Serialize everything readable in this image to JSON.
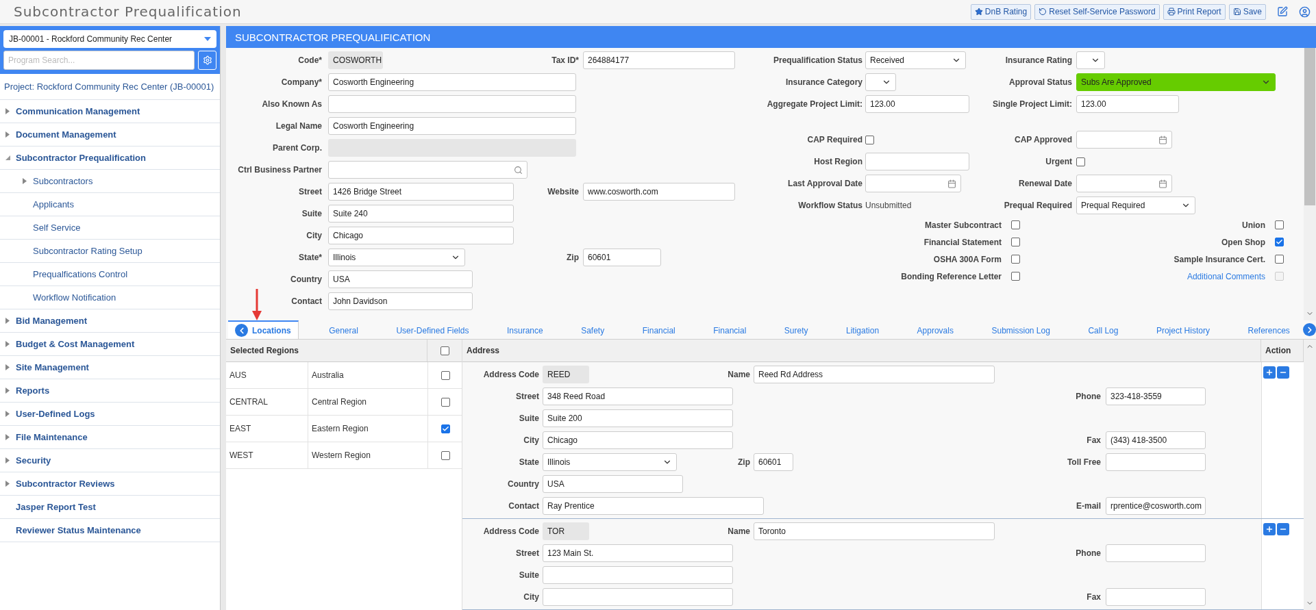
{
  "app": {
    "title": "Subcontractor Prequalification",
    "actions": [
      {
        "label": "DnB Rating"
      },
      {
        "label": "Reset Self-Service Password"
      },
      {
        "label": "Print Report"
      },
      {
        "label": "Save"
      }
    ]
  },
  "sidebar": {
    "project_select": "JB-00001 - Rockford Community Rec Center",
    "search_placeholder": "Program Search...",
    "project_link": "Project: Rockford Community Rec Center (JB-00001)",
    "nav": [
      {
        "label": "Communication Management",
        "expandable": true,
        "expanded": false
      },
      {
        "label": "Document Management",
        "expandable": true,
        "expanded": false
      },
      {
        "label": "Subcontractor Prequalification",
        "expandable": true,
        "expanded": true,
        "children": [
          {
            "label": "Subcontractors",
            "expandable": true,
            "expanded": false
          },
          {
            "label": "Applicants",
            "expandable": false
          },
          {
            "label": "Self Service",
            "expandable": false
          },
          {
            "label": "Subcontractor Rating Setup",
            "expandable": false
          },
          {
            "label": "Prequalfications Control",
            "expandable": false
          },
          {
            "label": "Workflow Notification",
            "expandable": false
          }
        ]
      },
      {
        "label": "Bid Management",
        "expandable": true,
        "expanded": false
      },
      {
        "label": "Budget & Cost Management",
        "expandable": true,
        "expanded": false
      },
      {
        "label": "Site Management",
        "expandable": true,
        "expanded": false
      },
      {
        "label": "Reports",
        "expandable": true,
        "expanded": false
      },
      {
        "label": "User-Defined Logs",
        "expandable": true,
        "expanded": false
      },
      {
        "label": "File Maintenance",
        "expandable": true,
        "expanded": false
      },
      {
        "label": "Security",
        "expandable": true,
        "expanded": false
      },
      {
        "label": "Subcontractor Reviews",
        "expandable": true,
        "expanded": false
      },
      {
        "label": "Jasper Report Test",
        "expandable": false
      },
      {
        "label": "Reviewer Status Maintenance",
        "expandable": false
      }
    ]
  },
  "form": {
    "title": "SUBCONTRACTOR PREQUALIFICATION",
    "identity_rows": [
      {
        "main": {
          "label": "Code*",
          "kind": "readonly",
          "value": "COSWORTH"
        },
        "side": {
          "label": "Tax ID*",
          "kind": "text",
          "value": "264884177"
        }
      },
      {
        "main": {
          "label": "Company*",
          "kind": "text",
          "value": "Cosworth Engineering"
        }
      },
      {
        "main": {
          "label": "Also Known As",
          "kind": "text"
        }
      },
      {
        "main": {
          "label": "Legal Name",
          "kind": "text",
          "value": "Cosworth Engineering"
        }
      },
      {
        "main": {
          "label": "Parent Corp.",
          "kind": "readonly"
        }
      },
      {
        "main": {
          "label": "Ctrl Business Partner",
          "kind": "lookup"
        }
      },
      {
        "main": {
          "label": "Street",
          "kind": "text",
          "value": "1426 Bridge Street"
        },
        "side": {
          "label": "Website",
          "kind": "text",
          "value": "www.cosworth.com"
        }
      },
      {
        "main": {
          "label": "Suite",
          "kind": "text",
          "value": "Suite 240"
        }
      },
      {
        "main": {
          "label": "City",
          "kind": "text",
          "value": "Chicago"
        }
      },
      {
        "main": {
          "label": "State*",
          "kind": "select",
          "value": "Illinois"
        },
        "side": {
          "label": "Zip",
          "kind": "text",
          "value": "60601"
        }
      },
      {
        "main": {
          "label": "Country",
          "kind": "text",
          "value": "USA"
        }
      },
      {
        "main": {
          "label": "Contact",
          "kind": "text",
          "value": "John Davidson"
        }
      }
    ],
    "status_groups": [
      [
        {
          "main": {
            "label": "Prequalification Status",
            "kind": "select",
            "value": "Received"
          },
          "side": {
            "label": "Insurance Rating",
            "kind": "select"
          }
        },
        {
          "main": {
            "label": "Insurance Category",
            "kind": "select"
          },
          "side": {
            "label": "Approval Status",
            "kind": "select",
            "value": "Subs Are Approved",
            "color": "#66cc00"
          }
        },
        {
          "main": {
            "label": "Aggregate Project Limit:",
            "kind": "text",
            "value": "123.00"
          },
          "side": {
            "label": "Single Project Limit:",
            "kind": "text",
            "value": "123.00"
          }
        }
      ],
      [
        {
          "main": {
            "label": "CAP Required",
            "kind": "checkbox",
            "checked": false
          },
          "side": {
            "label": "CAP Approved",
            "kind": "date"
          }
        },
        {
          "main": {
            "label": "Host Region",
            "kind": "text"
          },
          "side": {
            "label": "Urgent",
            "kind": "checkbox",
            "checked": false
          }
        },
        {
          "main": {
            "label": "Last Approval Date",
            "kind": "date"
          },
          "side": {
            "label": "Renewal Date",
            "kind": "date"
          }
        },
        {
          "main": {
            "label": "Workflow Status",
            "kind": "static",
            "value": "Unsubmitted"
          },
          "side": {
            "label": "Prequal Required",
            "kind": "select",
            "value": "Prequal Required"
          }
        }
      ]
    ],
    "document_checks": [
      {
        "main": {
          "label": "Master Subcontract",
          "kind": "plain",
          "checked": false,
          "disabled": false
        },
        "side": {
          "label": "Union",
          "kind": "plain",
          "checked": false,
          "disabled": false
        }
      },
      {
        "main": {
          "label": "Financial Statement",
          "kind": "plain",
          "checked": false,
          "disabled": false
        },
        "side": {
          "label": "Open Shop",
          "kind": "plain",
          "checked": true,
          "disabled": false
        }
      },
      {
        "main": {
          "label": "OSHA 300A Form",
          "kind": "plain",
          "checked": false,
          "disabled": false
        },
        "side": {
          "label": "Sample Insurance Cert.",
          "kind": "plain",
          "checked": false,
          "disabled": false
        }
      },
      {
        "main": {
          "label": "Bonding Reference Letter",
          "kind": "plain",
          "checked": false,
          "disabled": false
        },
        "side": {
          "label": "Additional Comments",
          "kind": "link",
          "checked": false,
          "disabled": true
        }
      }
    ]
  },
  "tabs": [
    {
      "label": "Locations",
      "selected": true
    },
    {
      "label": "General",
      "selected": false
    },
    {
      "label": "User-Defined Fields",
      "selected": false
    },
    {
      "label": "Insurance",
      "selected": false
    },
    {
      "label": "Safety",
      "selected": false
    },
    {
      "label": "Financial",
      "selected": false
    },
    {
      "label": "Financial",
      "selected": false
    },
    {
      "label": "Surety",
      "selected": false
    },
    {
      "label": "Litigation",
      "selected": false
    },
    {
      "label": "Approvals",
      "selected": false
    },
    {
      "label": "Submission Log",
      "selected": false
    },
    {
      "label": "Call Log",
      "selected": false
    },
    {
      "label": "Project History",
      "selected": false
    },
    {
      "label": "References",
      "selected": false
    }
  ],
  "regions": {
    "header": "Selected Regions",
    "all_checked": false,
    "rows": [
      {
        "code": "AUS",
        "name": "Australia",
        "checked": false
      },
      {
        "code": "CENTRAL",
        "name": "Central Region",
        "checked": false
      },
      {
        "code": "EAST",
        "name": "Eastern Region",
        "checked": true
      },
      {
        "code": "WEST",
        "name": "Western Region",
        "checked": false
      }
    ]
  },
  "addresses": {
    "header": "Address",
    "action_header": "Action",
    "items": [
      {
        "rows": [
          {
            "main": {
              "label": "Address Code",
              "kind": "readonly",
              "value": "REED"
            },
            "middle": {
              "label": "Name",
              "kind": "text",
              "value": "Reed Rd Address"
            }
          },
          {
            "main": {
              "label": "Street",
              "kind": "text",
              "value": "348 Reed Road"
            },
            "side": {
              "label": "Phone",
              "kind": "text",
              "value": "323-418-3559"
            }
          },
          {
            "main": {
              "label": "Suite",
              "kind": "text",
              "value": "Suite 200"
            }
          },
          {
            "main": {
              "label": "City",
              "kind": "text",
              "value": "Chicago"
            },
            "side": {
              "label": "Fax",
              "kind": "text",
              "value": "(343) 418-3500"
            }
          },
          {
            "main": {
              "label": "State",
              "kind": "select",
              "value": "Illinois"
            },
            "middle": {
              "label": "Zip",
              "kind": "text",
              "value": "60601"
            },
            "side": {
              "label": "Toll Free",
              "kind": "text"
            }
          },
          {
            "main": {
              "label": "Country",
              "kind": "text",
              "value": "USA"
            }
          },
          {
            "main": {
              "label": "Contact",
              "kind": "text",
              "value": "Ray Prentice"
            },
            "side": {
              "label": "E-mail",
              "kind": "text",
              "value": "rprentice@cosworth.com"
            }
          }
        ]
      },
      {
        "rows": [
          {
            "main": {
              "label": "Address Code",
              "kind": "readonly",
              "value": "TOR"
            },
            "middle": {
              "label": "Name",
              "kind": "text",
              "value": "Toronto"
            }
          },
          {
            "main": {
              "label": "Street",
              "kind": "text",
              "value": "123 Main St."
            },
            "side": {
              "label": "Phone",
              "kind": "text"
            }
          },
          {
            "main": {
              "label": "Suite",
              "kind": "text"
            }
          },
          {
            "main": {
              "label": "City",
              "kind": "text"
            },
            "side": {
              "label": "Fax",
              "kind": "text"
            }
          }
        ]
      }
    ]
  }
}
